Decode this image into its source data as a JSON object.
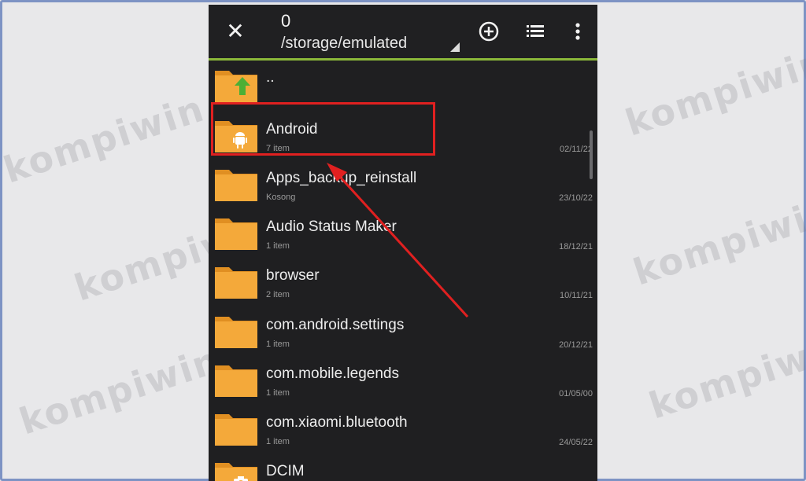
{
  "header": {
    "count": "0",
    "path": "/storage/emulated"
  },
  "icons": {
    "close": "close-icon",
    "add": "add-circle-icon",
    "list": "list-view-icon",
    "menu": "more-vert-icon"
  },
  "parent": {
    "name": ".."
  },
  "files": [
    {
      "name": "Android",
      "sub": "7 item",
      "date": "02/11/22",
      "badge": "android"
    },
    {
      "name": "Apps_backup_reinstall",
      "sub": "Kosong",
      "date": "23/10/22"
    },
    {
      "name": "Audio Status Maker",
      "sub": "1 item",
      "date": "18/12/21"
    },
    {
      "name": "browser",
      "sub": "2 item",
      "date": "10/11/21"
    },
    {
      "name": "com.android.settings",
      "sub": "1 item",
      "date": "20/12/21"
    },
    {
      "name": "com.mobile.legends",
      "sub": "1 item",
      "date": "01/05/00"
    },
    {
      "name": "com.xiaomi.bluetooth",
      "sub": "1 item",
      "date": "24/05/22"
    },
    {
      "name": "DCIM",
      "sub": "",
      "date": "",
      "badge": "camera"
    }
  ],
  "watermark": "kompiwin",
  "colors": {
    "folder": "#f4a93a",
    "folderTab": "#e08f22",
    "accent": "#8bb83a",
    "highlight": "#e02020",
    "background": "#1f1f21"
  }
}
